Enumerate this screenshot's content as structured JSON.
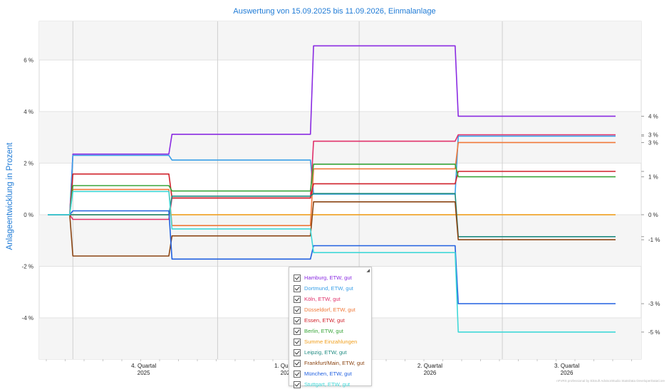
{
  "title": "Auswertung von 15.09.2025 bis 11.09.2026, Einmalanlage",
  "footer": "nFVRS professional by Eiknuft AdvisorStudio StatsData DeveloperDataCore",
  "chart_data": {
    "type": "line",
    "title": "Auswertung von 15.09.2025 bis 11.09.2026, Einmalanlage",
    "ylabel": "Anlageentwicklung  in Prozent",
    "xlabel": "",
    "ylim": [
      -5.6,
      7.5
    ],
    "grid": true,
    "legend_position": "bottom-center (overlay)",
    "y_ticks": [
      {
        "v": 6,
        "label": "6 %"
      },
      {
        "v": 4,
        "label": "4 %"
      },
      {
        "v": 2,
        "label": "2 %"
      },
      {
        "v": 0,
        "label": "0 %"
      },
      {
        "v": -2,
        "label": "-2 %"
      },
      {
        "v": -4,
        "label": "-4 %"
      }
    ],
    "x_domain": [
      "2025-09-15",
      "2026-09-11"
    ],
    "x_quarter_bounds": [
      "2025-10-01",
      "2026-01-01",
      "2026-04-01",
      "2026-07-01"
    ],
    "x_ticks": [
      {
        "center": "2025-11-15",
        "line1": "4. Quartal",
        "line2": "2025"
      },
      {
        "center": "2026-02-14",
        "line1": "1. Quartal",
        "line2": "2026"
      },
      {
        "center": "2026-05-16",
        "line1": "2. Quartal",
        "line2": "2026"
      },
      {
        "center": "2026-08-11",
        "line1": "3. Quartal",
        "line2": "2026"
      }
    ],
    "step_dates": [
      "2025-09-15",
      "2025-09-29",
      "2025-10-01",
      "2025-12-01",
      "2025-12-03",
      "2026-03-01",
      "2026-03-03",
      "2026-06-01",
      "2026-06-03",
      "2026-09-11"
    ],
    "series": [
      {
        "name": "Hamburg, ETW, gut",
        "color": "#8a2be2",
        "values": [
          0,
          0,
          2.35,
          2.35,
          3.12,
          3.12,
          6.55,
          6.55,
          3.82,
          3.82
        ],
        "end_label": "4 %"
      },
      {
        "name": "Dortmund, ETW, gut",
        "color": "#3aa0e8",
        "values": [
          0,
          0,
          2.3,
          2.3,
          2.12,
          2.12,
          0.8,
          0.8,
          3.05,
          3.05
        ],
        "end_label": ""
      },
      {
        "name": "Köln, ETW, gut",
        "color": "#e0306a",
        "values": [
          0,
          0,
          -0.18,
          -0.18,
          0.65,
          0.65,
          2.85,
          2.85,
          3.1,
          3.1
        ],
        "end_label": "3 %"
      },
      {
        "name": "Düsseldorf, ETW, gut",
        "color": "#f07838",
        "values": [
          0,
          0,
          0.98,
          0.98,
          -0.42,
          -0.42,
          1.78,
          1.78,
          2.8,
          2.8
        ],
        "end_label": "3 %"
      },
      {
        "name": "Essen, ETW, gut",
        "color": "#d0202a",
        "values": [
          0,
          0,
          1.58,
          1.58,
          0.65,
          0.65,
          1.2,
          1.2,
          1.68,
          1.68
        ],
        "end_label": ""
      },
      {
        "name": "Berlin, ETW, gut",
        "color": "#3aa63a",
        "values": [
          0,
          0,
          1.13,
          1.13,
          0.92,
          0.92,
          1.96,
          1.96,
          1.47,
          1.47
        ],
        "end_label": "1 %"
      },
      {
        "name": "Summe Einzahlungen",
        "color": "#f0a020",
        "values": [
          0,
          0,
          0,
          0,
          0,
          0,
          0,
          0,
          0,
          0
        ],
        "end_label": "0 %"
      },
      {
        "name": "Leipzig, ETW, gut",
        "color": "#1e8a80",
        "values": [
          0,
          0,
          0,
          0,
          0.72,
          0.72,
          0.82,
          0.82,
          -0.85,
          -0.85
        ],
        "end_label": ""
      },
      {
        "name": "Frankfurt/Main, ETW, gut",
        "color": "#8b4513",
        "values": [
          0,
          0,
          -1.6,
          -1.6,
          -0.82,
          -0.82,
          0.5,
          0.5,
          -0.97,
          -0.97
        ],
        "end_label": "-1 %"
      },
      {
        "name": "München, ETW, gut",
        "color": "#2060e0",
        "values": [
          0,
          0,
          0.15,
          0.15,
          -1.72,
          -1.72,
          -1.2,
          -1.2,
          -3.45,
          -3.45
        ],
        "end_label": "-3 %"
      },
      {
        "name": "Stuttgart, ETW, gut",
        "color": "#40d8d8",
        "values": [
          0,
          0,
          0.9,
          0.9,
          -0.55,
          -0.55,
          -1.47,
          -1.47,
          -4.55,
          -4.55
        ],
        "end_label": "-5 %"
      }
    ]
  }
}
